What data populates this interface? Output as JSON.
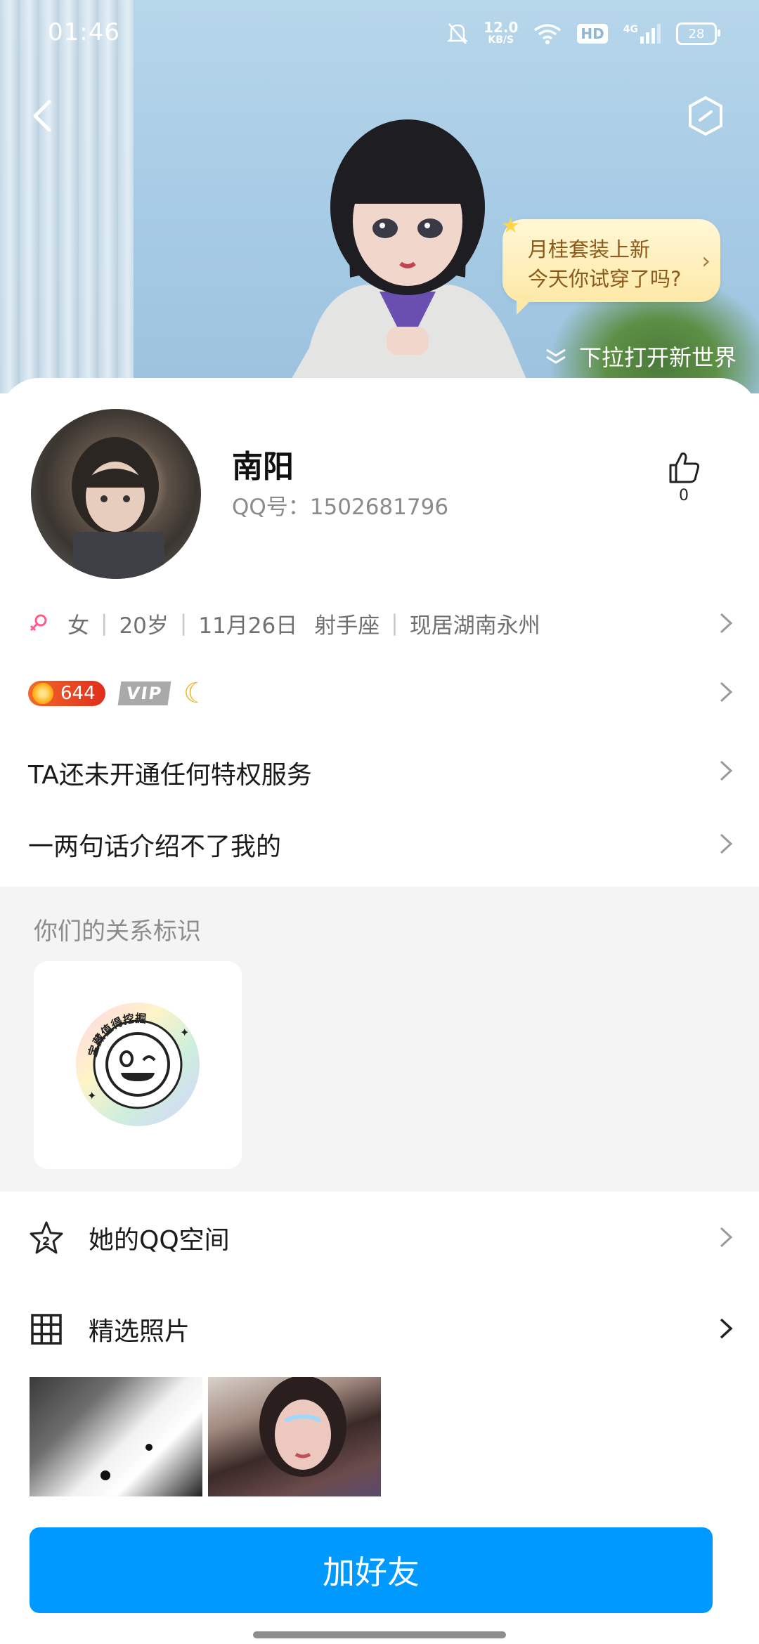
{
  "status_bar": {
    "time": "01:46",
    "net_speed": "12.0",
    "net_unit": "KB/S",
    "hd": "HD",
    "signal": "4G",
    "battery": "28"
  },
  "hero": {
    "bubble_line1": "月桂套装上新",
    "bubble_line2": "今天你试穿了吗?",
    "pull_hint": "下拉打开新世界"
  },
  "profile": {
    "name": "南阳",
    "qq_label": "QQ号：",
    "qq_number": "1502681796",
    "like_count": "0",
    "gender": "女",
    "age": "20岁",
    "birthday": "11月26日",
    "zodiac": "射手座",
    "location": "现居湖南永州",
    "level": "644",
    "vip": "VIP"
  },
  "rows": {
    "privilege": "TA还未开通任何特权服务",
    "signature": "一两句话介绍不了我的"
  },
  "relation": {
    "title": "你们的关系标识",
    "sticker_text": "宝藏值得挖掘"
  },
  "menu": {
    "qzone": "她的QQ空间",
    "photos": "精选照片"
  },
  "actions": {
    "add_friend": "加好友"
  },
  "colors": {
    "primary": "#0099ff",
    "secondary_text": "#8b8b8b",
    "section_bg": "#f4f4f4"
  }
}
